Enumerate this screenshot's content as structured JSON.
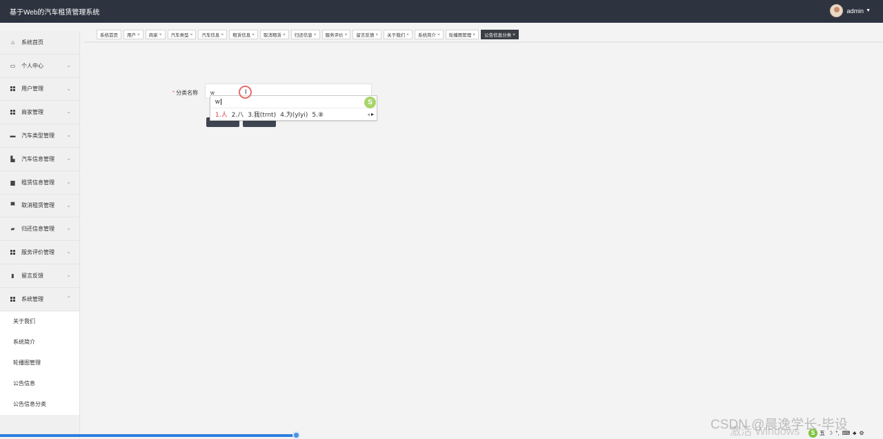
{
  "app": {
    "title": "基于Web的汽车租赁管理系统"
  },
  "user": {
    "name": "admin"
  },
  "sidebar": {
    "items": [
      {
        "label": "系统首页",
        "icon": "home-icon",
        "has_chevron": false
      },
      {
        "label": "个人中心",
        "icon": "calendar-icon",
        "has_chevron": true
      },
      {
        "label": "用户管理",
        "icon": "grid-icon",
        "has_chevron": true
      },
      {
        "label": "商家管理",
        "icon": "grid-icon",
        "has_chevron": true
      },
      {
        "label": "汽车类型管理",
        "icon": "briefcase-icon",
        "has_chevron": true
      },
      {
        "label": "汽车信息管理",
        "icon": "car-icon",
        "has_chevron": true
      },
      {
        "label": "租赁信息管理",
        "icon": "box-icon",
        "has_chevron": true
      },
      {
        "label": "取消租赁管理",
        "icon": "chat-icon",
        "has_chevron": true
      },
      {
        "label": "归还信息管理",
        "icon": "ticket-icon",
        "has_chevron": true
      },
      {
        "label": "服务评价管理",
        "icon": "grid-icon",
        "has_chevron": true
      },
      {
        "label": "留言反馈",
        "icon": "clipboard-icon",
        "has_chevron": true
      },
      {
        "label": "系统管理",
        "icon": "grid-icon",
        "has_chevron": true,
        "expanded": true
      }
    ],
    "sub_items": [
      {
        "label": "关于我们"
      },
      {
        "label": "系统简介"
      },
      {
        "label": "轮播图管理"
      },
      {
        "label": "公告信息"
      },
      {
        "label": "公告信息分类"
      }
    ]
  },
  "tabs": [
    {
      "label": "系统首页",
      "closable": false
    },
    {
      "label": "用户",
      "closable": true
    },
    {
      "label": "商家",
      "closable": true
    },
    {
      "label": "汽车类型",
      "closable": true
    },
    {
      "label": "汽车信息",
      "closable": true
    },
    {
      "label": "租赁信息",
      "closable": true
    },
    {
      "label": "取消租赁",
      "closable": true
    },
    {
      "label": "归还信息",
      "closable": true
    },
    {
      "label": "服务评价",
      "closable": true
    },
    {
      "label": "留言反馈",
      "closable": true
    },
    {
      "label": "关于我们",
      "closable": true
    },
    {
      "label": "系统简介",
      "closable": true
    },
    {
      "label": "轮播图管理",
      "closable": true
    },
    {
      "label": "公告信息分类",
      "closable": true,
      "active": true
    }
  ],
  "form": {
    "required_mark": "*",
    "label": "分类名称",
    "value": "w"
  },
  "ime": {
    "composition": "w",
    "candidates": [
      "1.人",
      "2.八",
      "3.我(trnt)",
      "4.为(ylyi)",
      "5.⑧"
    ],
    "logo": "S"
  },
  "taskbar": {
    "watermark": "CSDN @晨逸学长-毕设",
    "watermark_overlay": "激活 Windows",
    "tray_items": [
      "五",
      "☽",
      "°,",
      "⌨",
      "♣",
      "⚙"
    ]
  },
  "colors": {
    "topbar": "#2d3440",
    "active_tab": "#3b3f45",
    "required": "#f56c6c",
    "progress": "#2c7de0"
  }
}
